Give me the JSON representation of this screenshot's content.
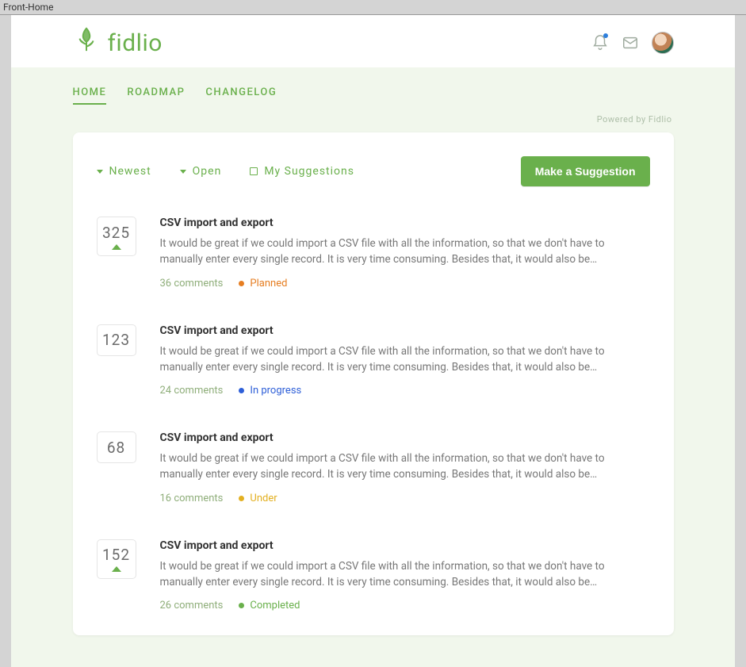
{
  "browser_tab": "Front-Home",
  "brand": "fidlio",
  "nav": {
    "items": [
      {
        "label": "HOME",
        "active": true
      },
      {
        "label": "ROADMAP",
        "active": false
      },
      {
        "label": "CHANGELOG",
        "active": false
      }
    ]
  },
  "powered_by": "Powered by Fidlio",
  "filters": {
    "sort": "Newest",
    "status": "Open",
    "mine": "My Suggestions"
  },
  "cta_label": "Make a Suggestion",
  "suggestions": [
    {
      "votes": "325",
      "show_up": true,
      "title": "CSV import and export",
      "desc": "It would be great if we could import a CSV file with all the information, so that we don't have to manually enter every single record. It is very time consuming. Besides that, it would also be…",
      "comments": "36 comments",
      "status_class": "planned",
      "status_label": "Planned"
    },
    {
      "votes": "123",
      "show_up": false,
      "title": "CSV import and export",
      "desc": "It would be great if we could import a CSV file with all the information, so that we don't have to manually enter every single record. It is very time consuming. Besides that, it would also be…",
      "comments": "24 comments",
      "status_class": "inprogress",
      "status_label": "In progress"
    },
    {
      "votes": "68",
      "show_up": false,
      "title": "CSV import and export",
      "desc": "It would be great if we could import a CSV file with all the information, so that we don't have to manually enter every single record. It is very time consuming. Besides that, it would also be…",
      "comments": "16 comments",
      "status_class": "under",
      "status_label": "Under"
    },
    {
      "votes": "152",
      "show_up": true,
      "title": "CSV import and export",
      "desc": "It would be great if we could import a CSV file with all the information, so that we don't have to manually enter every single record. It is very time consuming. Besides that, it would also be…",
      "comments": "26 comments",
      "status_class": "completed",
      "status_label": "Completed"
    }
  ]
}
